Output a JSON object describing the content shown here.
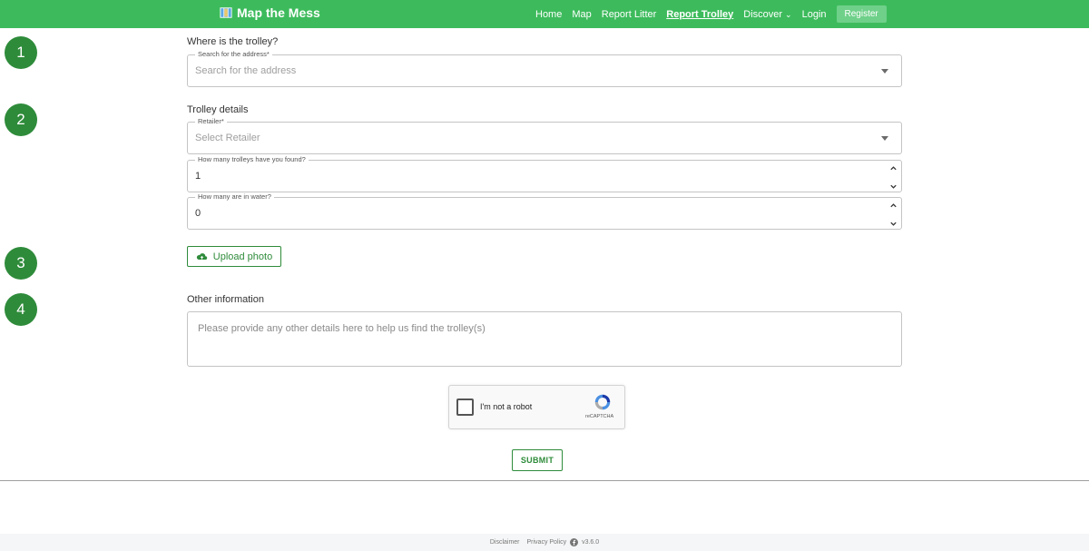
{
  "header": {
    "brand": "Map the Mess",
    "brand_icon": "map-icon",
    "nav": {
      "home": "Home",
      "map": "Map",
      "report_litter": "Report Litter",
      "report_trolley": "Report Trolley",
      "discover": "Discover",
      "login": "Login",
      "register": "Register"
    },
    "accent_color": "#3dbb5c"
  },
  "steps": [
    "1",
    "2",
    "3",
    "4"
  ],
  "location": {
    "title": "Where is the trolley?",
    "search_label": "Search for the address*",
    "search_placeholder": "Search for the address"
  },
  "details": {
    "title": "Trolley details",
    "retailer_label": "Retailer*",
    "retailer_placeholder": "Select Retailer",
    "count_label": "How many trolleys have you found?",
    "count_value": "1",
    "water_label": "How many are in water?",
    "water_value": "0"
  },
  "upload": {
    "label": "Upload photo",
    "icon": "cloud-upload-icon"
  },
  "other": {
    "title": "Other information",
    "placeholder": "Please provide any other details here to help us find the trolley(s)"
  },
  "recaptcha": {
    "label": "I'm not a robot",
    "brand": "reCAPTCHA"
  },
  "submit_label": "SUBMIT",
  "footer": {
    "disclaimer": "Disclaimer",
    "privacy": "Privacy Policy",
    "version": "v3.6.0"
  },
  "colors": {
    "primary_green": "#2e8b3a",
    "step_circle": "#2e8b3a"
  }
}
